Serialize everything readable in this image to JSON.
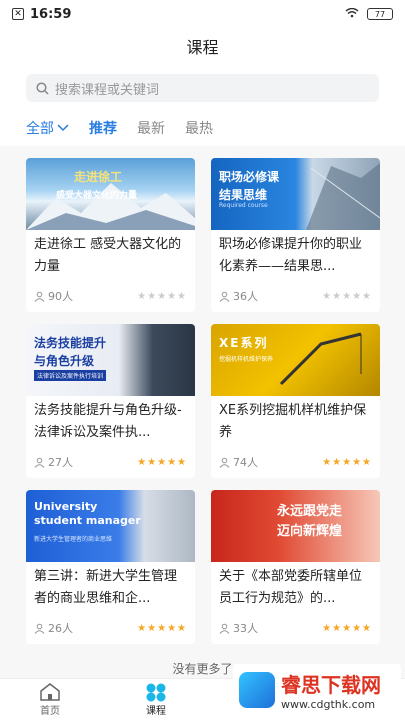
{
  "status": {
    "time": "16:59",
    "battery": "77"
  },
  "header": {
    "title": "课程"
  },
  "search": {
    "placeholder": "搜索课程或关键词"
  },
  "tabs": {
    "all": "全部",
    "items": [
      "推荐",
      "最新",
      "最热"
    ]
  },
  "courses": [
    {
      "title": "走进徐工 感受大器文化的力量",
      "count": "90人",
      "thumb_t1": "走进徐工",
      "thumb_t2": "感受大器文化的力量",
      "thumb_t3": "",
      "stars": "★★★★★",
      "stars_filled": false
    },
    {
      "title": "职场必修课提升你的职业化素养——结果思...",
      "count": "36人",
      "thumb_t1": "职场必修课",
      "thumb_t2": "结果思维",
      "thumb_t3": "Required course",
      "stars": "★★★★★",
      "stars_filled": false
    },
    {
      "title": "法务技能提升与角色升级-法律诉讼及案件执...",
      "count": "27人",
      "thumb_t1": "法务技能提升",
      "thumb_t2": "与角色升级",
      "thumb_t3": "法律诉讼及案件执行培训",
      "stars": "★★★★★",
      "stars_filled": true
    },
    {
      "title": "XE系列挖掘机样机维护保养",
      "count": "74人",
      "thumb_t1": "XE系列",
      "thumb_t2": "",
      "thumb_t3": "挖掘机样机维护保养",
      "stars": "★★★★★",
      "stars_filled": true
    },
    {
      "title": "第三讲：新进大学生管理者的商业思维和企...",
      "count": "26人",
      "thumb_t1": "University",
      "thumb_t2": "student manager",
      "thumb_t3": "新进大学生管理者的商业思维",
      "stars": "★★★★★",
      "stars_filled": true
    },
    {
      "title": "关于《本部党委所辖单位员工行为规范》的...",
      "count": "33人",
      "thumb_t1": "永远跟党走",
      "thumb_t2": "迈向新辉煌",
      "thumb_t3": "",
      "stars": "★★★★★",
      "stars_filled": true
    }
  ],
  "footer": {
    "nomore": "没有更多了"
  },
  "nav": {
    "home": "首页",
    "course": "课程"
  },
  "watermark": {
    "name": "睿思下载网",
    "url": "www.cdgthk.com"
  }
}
